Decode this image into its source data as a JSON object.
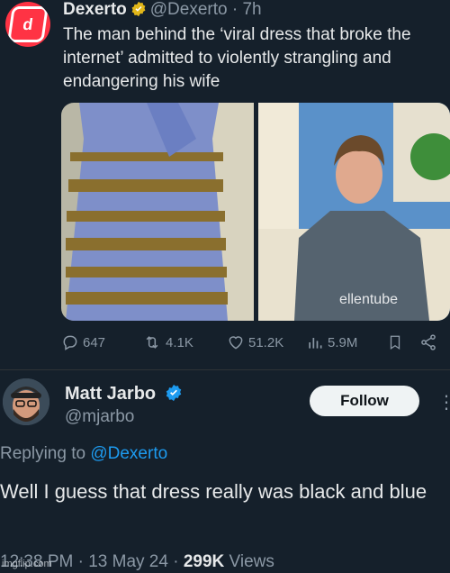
{
  "tweet": {
    "author_name": "Dexerto",
    "author_handle": "@Dexerto",
    "time": "· 7h",
    "text": "The man behind the ‘viral dress that broke the internet’ admitted to violently strangling and endangering his wife",
    "media_watermark": "ellentube",
    "stats": {
      "replies": "647",
      "retweets": "4.1K",
      "likes": "51.2K",
      "views": "5.9M"
    }
  },
  "reply": {
    "author_name": "Matt Jarbo",
    "author_handle": "@mjarbo",
    "follow_label": "Follow",
    "more_label": "⋮",
    "replying_prefix": "Replying to",
    "replying_handle": "@Dexerto",
    "text": "Well I guess that dress really was black and blue",
    "time": "12:38 PM",
    "date": "13 May 24",
    "views_count": "299K",
    "views_label": "Views"
  },
  "watermark": "imgflip.com",
  "colors": {
    "background": "#15202b",
    "accent": "#1d9bf0",
    "muted": "#8b98a5",
    "verified_gold": "#e2b719"
  }
}
